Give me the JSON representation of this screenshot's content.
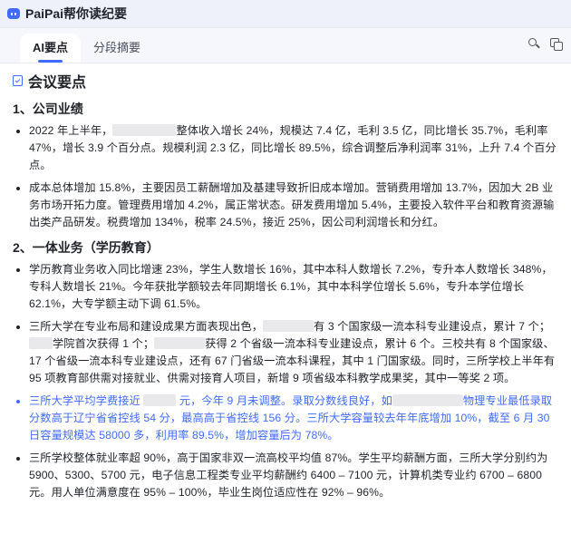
{
  "app": {
    "title": "PaiPai帮你读纪要",
    "logo_icon": "robot-face-icon"
  },
  "tabs": [
    {
      "label": "AI要点",
      "active": true
    },
    {
      "label": "分段摘要",
      "active": false
    }
  ],
  "tools": {
    "search_icon": "search-icon",
    "copy_icon": "copy-icon"
  },
  "section": {
    "title": "会议要点",
    "icon": "note-check-icon"
  },
  "colors": {
    "accent": "#3f6bff",
    "text": "#1f2329",
    "redact": "#e9e9ec"
  },
  "topics": [
    {
      "heading": "1、公司业绩",
      "bullets": [
        {
          "highlight": false,
          "parts": [
            {
              "t": "2022 年上半年，"
            },
            {
              "redact": 70
            },
            {
              "t": "整体收入增长 24%，规模达 7.4 亿，毛利 3.5 亿，同比增长 35.7%，毛利率 47%，增长 3.9 个百分点。规模利润 2.3 亿，同比增长 89.5%，综合调整后净利润率 31%，上升 7.4 个百分点。"
            }
          ]
        },
        {
          "highlight": false,
          "parts": [
            {
              "t": "成本总体增加 15.8%，主要因员工薪酬增加及基建导致折旧成本增加。营销费用增加 13.7%，因加大 2B 业务市场开拓力度。管理费用增加 4.2%，属正常状态。研发费用增加 5.4%，主要投入软件平台和教育资源输出类产品研发。税费增加 134%，税率 24.5%，接近 25%，因公司利润增长和分红。"
            }
          ]
        }
      ]
    },
    {
      "heading": "2、一体业务（学历教育）",
      "bullets": [
        {
          "highlight": false,
          "parts": [
            {
              "t": "学历教育业务收入同比增速 23%，学生人数增长 16%，其中本科人数增长 7.2%，专升本人数增长 348%，专科人数增长 21%。今年获批学额较去年同期增长 6.1%，其中本科学位增长 5.6%，专升本学位增长 62.1%，大专学额主动下调 61.5%。"
            }
          ]
        },
        {
          "highlight": false,
          "parts": [
            {
              "t": "三所大学在专业布局和建设成果方面表现出色，"
            },
            {
              "redact": 56
            },
            {
              "t": "有 3 个国家级一流本科专业建设点，累计 7 个；"
            },
            {
              "redact": 26
            },
            {
              "t": "学院首次获得 1 个；"
            },
            {
              "redact": 56
            },
            {
              "t": "获得 2 个省级一流本科专业建设点，累计 6 个。三校共有 8 个国家级、17 个省级一流本科专业建设点，还有 67 门省级一流本科课程，其中 1 门国家级。同时，三所学校上半年有 95 项教育部供需对接就业、供需对接育人项目，新增 9 项省级本科教学成果奖，其中一等奖 2 项。"
            }
          ]
        },
        {
          "highlight": true,
          "parts": [
            {
              "t": "三所大学平均学费接近 "
            },
            {
              "redact": 36
            },
            {
              "t": " 元，今年 9 月未调整。录取分数线良好，如"
            },
            {
              "redact": 78
            },
            {
              "t": "物理专业最低录取分数高于辽宁省省控线 54 分，最高高于省控线 156 分。三所大学容量较去年年底增加 10%，截至 6 月 30 日容量规模达 58000 多，利用率 89.5%，增加容量后为 78%。"
            }
          ]
        },
        {
          "highlight": false,
          "parts": [
            {
              "t": "三所学校整体就业率超 90%，高于国家非双一流高校平均值 87%。学生平均薪酬方面，三所大学分别约为 5900、5300、5700 元，电子信息工程类专业平均薪酬约 6400 – 7100 元，计算机类专业约 6700 – 6800 元。用人单位满意度在 95% – 100%，毕业生岗位适应性在 92% – 96%。"
            }
          ]
        }
      ]
    }
  ]
}
